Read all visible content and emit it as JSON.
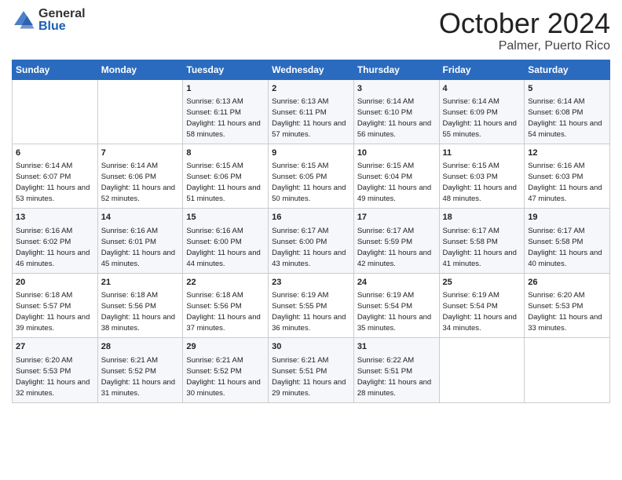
{
  "header": {
    "logo_general": "General",
    "logo_blue": "Blue",
    "month_title": "October 2024",
    "location": "Palmer, Puerto Rico"
  },
  "days_of_week": [
    "Sunday",
    "Monday",
    "Tuesday",
    "Wednesday",
    "Thursday",
    "Friday",
    "Saturday"
  ],
  "weeks": [
    [
      {
        "day": "",
        "sunrise": "",
        "sunset": "",
        "daylight": ""
      },
      {
        "day": "",
        "sunrise": "",
        "sunset": "",
        "daylight": ""
      },
      {
        "day": "1",
        "sunrise": "Sunrise: 6:13 AM",
        "sunset": "Sunset: 6:11 PM",
        "daylight": "Daylight: 11 hours and 58 minutes."
      },
      {
        "day": "2",
        "sunrise": "Sunrise: 6:13 AM",
        "sunset": "Sunset: 6:11 PM",
        "daylight": "Daylight: 11 hours and 57 minutes."
      },
      {
        "day": "3",
        "sunrise": "Sunrise: 6:14 AM",
        "sunset": "Sunset: 6:10 PM",
        "daylight": "Daylight: 11 hours and 56 minutes."
      },
      {
        "day": "4",
        "sunrise": "Sunrise: 6:14 AM",
        "sunset": "Sunset: 6:09 PM",
        "daylight": "Daylight: 11 hours and 55 minutes."
      },
      {
        "day": "5",
        "sunrise": "Sunrise: 6:14 AM",
        "sunset": "Sunset: 6:08 PM",
        "daylight": "Daylight: 11 hours and 54 minutes."
      }
    ],
    [
      {
        "day": "6",
        "sunrise": "Sunrise: 6:14 AM",
        "sunset": "Sunset: 6:07 PM",
        "daylight": "Daylight: 11 hours and 53 minutes."
      },
      {
        "day": "7",
        "sunrise": "Sunrise: 6:14 AM",
        "sunset": "Sunset: 6:06 PM",
        "daylight": "Daylight: 11 hours and 52 minutes."
      },
      {
        "day": "8",
        "sunrise": "Sunrise: 6:15 AM",
        "sunset": "Sunset: 6:06 PM",
        "daylight": "Daylight: 11 hours and 51 minutes."
      },
      {
        "day": "9",
        "sunrise": "Sunrise: 6:15 AM",
        "sunset": "Sunset: 6:05 PM",
        "daylight": "Daylight: 11 hours and 50 minutes."
      },
      {
        "day": "10",
        "sunrise": "Sunrise: 6:15 AM",
        "sunset": "Sunset: 6:04 PM",
        "daylight": "Daylight: 11 hours and 49 minutes."
      },
      {
        "day": "11",
        "sunrise": "Sunrise: 6:15 AM",
        "sunset": "Sunset: 6:03 PM",
        "daylight": "Daylight: 11 hours and 48 minutes."
      },
      {
        "day": "12",
        "sunrise": "Sunrise: 6:16 AM",
        "sunset": "Sunset: 6:03 PM",
        "daylight": "Daylight: 11 hours and 47 minutes."
      }
    ],
    [
      {
        "day": "13",
        "sunrise": "Sunrise: 6:16 AM",
        "sunset": "Sunset: 6:02 PM",
        "daylight": "Daylight: 11 hours and 46 minutes."
      },
      {
        "day": "14",
        "sunrise": "Sunrise: 6:16 AM",
        "sunset": "Sunset: 6:01 PM",
        "daylight": "Daylight: 11 hours and 45 minutes."
      },
      {
        "day": "15",
        "sunrise": "Sunrise: 6:16 AM",
        "sunset": "Sunset: 6:00 PM",
        "daylight": "Daylight: 11 hours and 44 minutes."
      },
      {
        "day": "16",
        "sunrise": "Sunrise: 6:17 AM",
        "sunset": "Sunset: 6:00 PM",
        "daylight": "Daylight: 11 hours and 43 minutes."
      },
      {
        "day": "17",
        "sunrise": "Sunrise: 6:17 AM",
        "sunset": "Sunset: 5:59 PM",
        "daylight": "Daylight: 11 hours and 42 minutes."
      },
      {
        "day": "18",
        "sunrise": "Sunrise: 6:17 AM",
        "sunset": "Sunset: 5:58 PM",
        "daylight": "Daylight: 11 hours and 41 minutes."
      },
      {
        "day": "19",
        "sunrise": "Sunrise: 6:17 AM",
        "sunset": "Sunset: 5:58 PM",
        "daylight": "Daylight: 11 hours and 40 minutes."
      }
    ],
    [
      {
        "day": "20",
        "sunrise": "Sunrise: 6:18 AM",
        "sunset": "Sunset: 5:57 PM",
        "daylight": "Daylight: 11 hours and 39 minutes."
      },
      {
        "day": "21",
        "sunrise": "Sunrise: 6:18 AM",
        "sunset": "Sunset: 5:56 PM",
        "daylight": "Daylight: 11 hours and 38 minutes."
      },
      {
        "day": "22",
        "sunrise": "Sunrise: 6:18 AM",
        "sunset": "Sunset: 5:56 PM",
        "daylight": "Daylight: 11 hours and 37 minutes."
      },
      {
        "day": "23",
        "sunrise": "Sunrise: 6:19 AM",
        "sunset": "Sunset: 5:55 PM",
        "daylight": "Daylight: 11 hours and 36 minutes."
      },
      {
        "day": "24",
        "sunrise": "Sunrise: 6:19 AM",
        "sunset": "Sunset: 5:54 PM",
        "daylight": "Daylight: 11 hours and 35 minutes."
      },
      {
        "day": "25",
        "sunrise": "Sunrise: 6:19 AM",
        "sunset": "Sunset: 5:54 PM",
        "daylight": "Daylight: 11 hours and 34 minutes."
      },
      {
        "day": "26",
        "sunrise": "Sunrise: 6:20 AM",
        "sunset": "Sunset: 5:53 PM",
        "daylight": "Daylight: 11 hours and 33 minutes."
      }
    ],
    [
      {
        "day": "27",
        "sunrise": "Sunrise: 6:20 AM",
        "sunset": "Sunset: 5:53 PM",
        "daylight": "Daylight: 11 hours and 32 minutes."
      },
      {
        "day": "28",
        "sunrise": "Sunrise: 6:21 AM",
        "sunset": "Sunset: 5:52 PM",
        "daylight": "Daylight: 11 hours and 31 minutes."
      },
      {
        "day": "29",
        "sunrise": "Sunrise: 6:21 AM",
        "sunset": "Sunset: 5:52 PM",
        "daylight": "Daylight: 11 hours and 30 minutes."
      },
      {
        "day": "30",
        "sunrise": "Sunrise: 6:21 AM",
        "sunset": "Sunset: 5:51 PM",
        "daylight": "Daylight: 11 hours and 29 minutes."
      },
      {
        "day": "31",
        "sunrise": "Sunrise: 6:22 AM",
        "sunset": "Sunset: 5:51 PM",
        "daylight": "Daylight: 11 hours and 28 minutes."
      },
      {
        "day": "",
        "sunrise": "",
        "sunset": "",
        "daylight": ""
      },
      {
        "day": "",
        "sunrise": "",
        "sunset": "",
        "daylight": ""
      }
    ]
  ]
}
